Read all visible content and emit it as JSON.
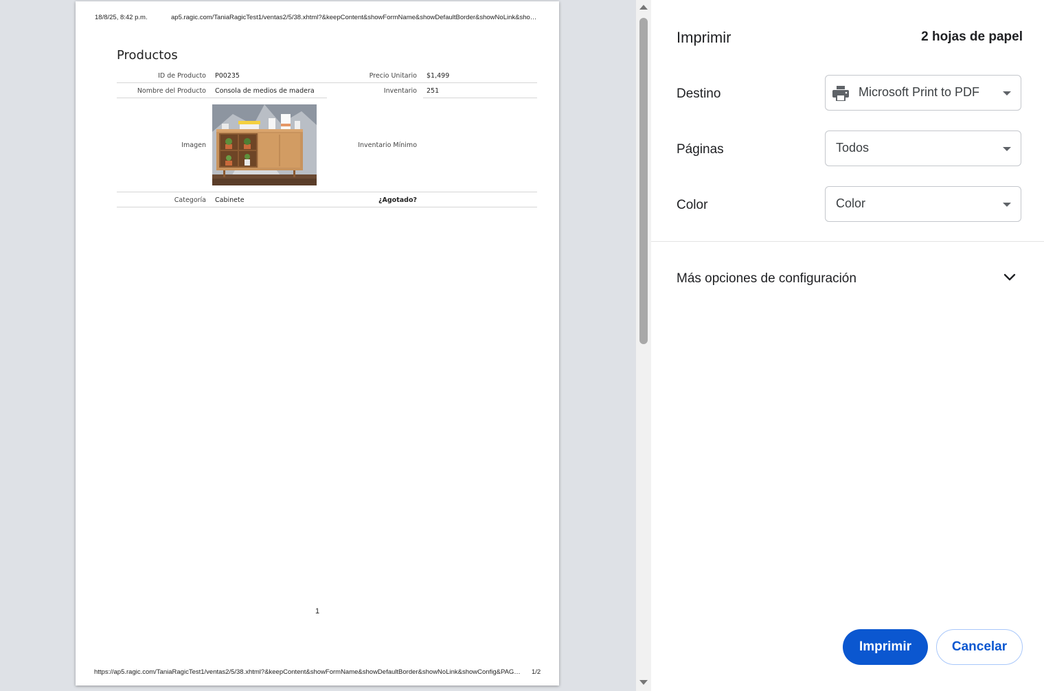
{
  "preview": {
    "header_date": "18/8/25, 8:42 p.m.",
    "header_url": "ap5.ragic.com/TaniaRagicTest1/ventas2/5/38.xhtml?&keepContent&showFormName&showDefaultBorder&showNoLink&sho…",
    "footer_url": "https://ap5.ragic.com/TaniaRagicTest1/ventas2/5/38.xhtml?&keepContent&showFormName&showDefaultBorder&showNoLink&showConfig&PAG…",
    "footer_page": "1/2",
    "page_number": "1",
    "form": {
      "title": "Productos",
      "fields": {
        "id_label": "ID de Producto",
        "id_value": "P00235",
        "price_label": "Precio Unitario",
        "price_value": "$1,499",
        "name_label": "Nombre del Producto",
        "name_value": "Consola de medios de madera",
        "inventory_label": "Inventario",
        "inventory_value": "251",
        "image_label": "Imagen",
        "min_inventory_label": "Inventario Mínimo",
        "category_label": "Categoría",
        "category_value": "Cabinete",
        "sold_out_label": "¿Agotado?"
      }
    }
  },
  "settings": {
    "title": "Imprimir",
    "sheet_count": "2 hojas de papel",
    "destination_label": "Destino",
    "destination_value": "Microsoft Print to PDF",
    "pages_label": "Páginas",
    "pages_value": "Todos",
    "color_label": "Color",
    "color_value": "Color",
    "more_options": "Más opciones de configuración",
    "print_button": "Imprimir",
    "cancel_button": "Cancelar"
  },
  "colors": {
    "accent": "#0b57d0",
    "preview_bg": "#dee1e6"
  },
  "icons": {
    "printer": "printer-icon",
    "dropdown": "caret-down-icon",
    "expand": "chevron-down-icon"
  }
}
